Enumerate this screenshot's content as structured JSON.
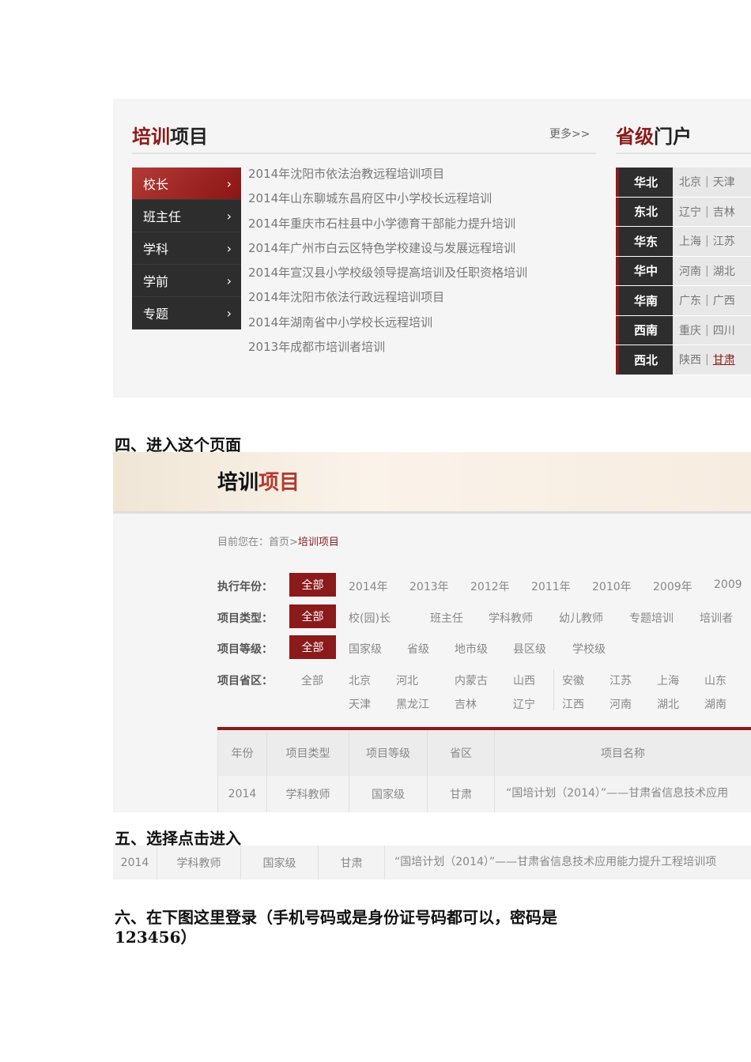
{
  "shot1": {
    "title_red": "培训",
    "title_black": "项目",
    "more": "更多>>",
    "menu": [
      "校长",
      "班主任",
      "学科",
      "学前",
      "专题"
    ],
    "chevron": "›",
    "projects": [
      "2014年沈阳市依法治教远程培训项目",
      "2014年山东聊城东昌府区中小学校长远程培训",
      "2014年重庆市石柱县中小学德育干部能力提升培训",
      "2014年广州市白云区特色学校建设与发展远程培训",
      "2014年宣汉县小学校级领导提高培训及任职资格培训",
      "2014年沈阳市依法行政远程培训项目",
      "2014年湖南省中小学校长远程培训",
      "2013年成都市培训者培训"
    ],
    "portal_title_red": "省级",
    "portal_title_black": "门户",
    "regions": [
      {
        "name": "华北",
        "p": [
          "北京",
          "天津"
        ]
      },
      {
        "name": "东北",
        "p": [
          "辽宁",
          "吉林"
        ]
      },
      {
        "name": "华东",
        "p": [
          "上海",
          "江苏"
        ]
      },
      {
        "name": "华中",
        "p": [
          "河南",
          "湖北"
        ]
      },
      {
        "name": "华南",
        "p": [
          "广东",
          "广西"
        ]
      },
      {
        "name": "西南",
        "p": [
          "重庆",
          "四川"
        ]
      },
      {
        "name": "西北",
        "p": [
          "陕西",
          "甘肃"
        ]
      }
    ],
    "sep": "|"
  },
  "heading4": "四、进入这个页面",
  "shot2": {
    "title_black": "培训",
    "title_red": "项目",
    "breadcrumb_prefix": "目前您在：首页>",
    "breadcrumb_current": "培训项目",
    "filters": {
      "year_label": "执行年份：",
      "type_label": "项目类型：",
      "level_label": "项目等级：",
      "prov_label": "项目省区：",
      "all": "全部",
      "years": [
        "2014年",
        "2013年",
        "2012年",
        "2011年",
        "2010年",
        "2009年",
        "2009"
      ],
      "types": [
        "校(园)长",
        "班主任",
        "学科教师",
        "幼儿教师",
        "专题培训",
        "培训者"
      ],
      "levels": [
        "国家级",
        "省级",
        "地市级",
        "县区级",
        "学校级"
      ],
      "prov_row1": [
        "北京",
        "河北",
        "内蒙古",
        "山西",
        "安徽",
        "江苏",
        "上海",
        "山东"
      ],
      "prov_row2": [
        "天津",
        "黑龙江",
        "吉林",
        "辽宁",
        "江西",
        "河南",
        "湖北",
        "湖南"
      ]
    },
    "table": {
      "headers": [
        "年份",
        "项目类型",
        "项目等级",
        "省区",
        "项目名称"
      ],
      "row": [
        "2014",
        "学科教师",
        "国家级",
        "甘肃",
        "“国培计划（2014）”——甘肃省信息技术应用"
      ]
    }
  },
  "heading5": "五、选择点击进入",
  "shot3": {
    "row": [
      "2014",
      "学科教师",
      "国家级",
      "甘肃",
      "“国培计划（2014）”——甘肃省信息技术应用能力提升工程培训项"
    ]
  },
  "heading6_line1": "六、在下图这里登录（手机号码或是身份证号码都可以，密码是",
  "heading6_line2": "123456）"
}
